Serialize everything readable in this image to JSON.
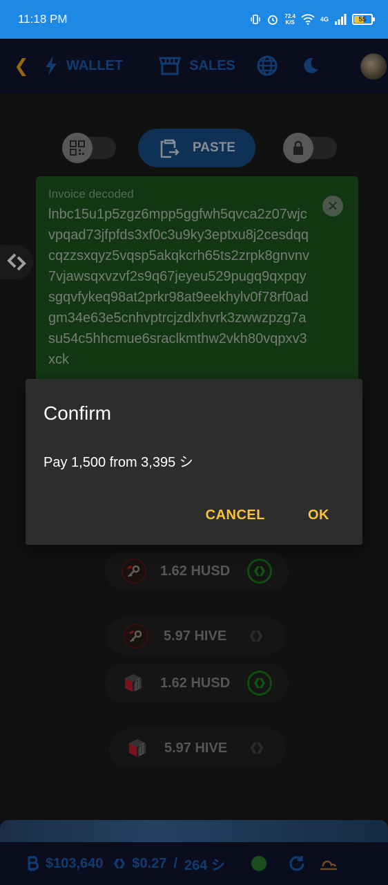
{
  "status_bar": {
    "time": "11:18 PM",
    "speed_value": "72.4",
    "speed_unit": "K/S",
    "network": "4G",
    "battery_level": "55"
  },
  "nav": {
    "wallet_label": "WALLET",
    "sales_label": "SALES"
  },
  "paste": {
    "label": "PASTE"
  },
  "invoice": {
    "label": "Invoice decoded",
    "code": "lnbc15u1p5zgz6mpp5ggfwh5qvca2z07wjcvpqad73jfpfds3xf0c3u9ky3eptxu8j2cesdqqcqzzsxqyz5vqsp5akqkcrh65ts2zrpk8gnvnv7vjawsqxvzvf2s9q67jeyeu529pugq9qxpqysgqvfykeq98at2prkr98at9eekhylv0f78rf0adgm34e63e5cnhvptrcjzdlxhvrk3zwwzpzg7asu54c5hhcmue6sraclkmthw2vkh80vqpxv3xck"
  },
  "dialog": {
    "title": "Confirm",
    "message": "Pay 1,500 from 3,395 シ",
    "cancel_label": "CANCEL",
    "ok_label": "OK"
  },
  "balances": [
    {
      "amount": "1.62 HUSD"
    },
    {
      "amount": "5.97 HIVE"
    },
    {
      "amount": "1.62 HUSD"
    },
    {
      "amount": "5.97 HIVE"
    }
  ],
  "bottom_bar": {
    "btc_price": "$103,640",
    "hive_price": "$0.27",
    "separator": "/",
    "sats": "264 シ"
  },
  "colors": {
    "status_bar": "#1e88e5",
    "nav_bg": "#0f1530",
    "nav_text": "#1e5fb5",
    "accent_orange": "#f5a623",
    "dialog_button": "#f7c236",
    "invoice_bg": "#1f5a1f"
  }
}
